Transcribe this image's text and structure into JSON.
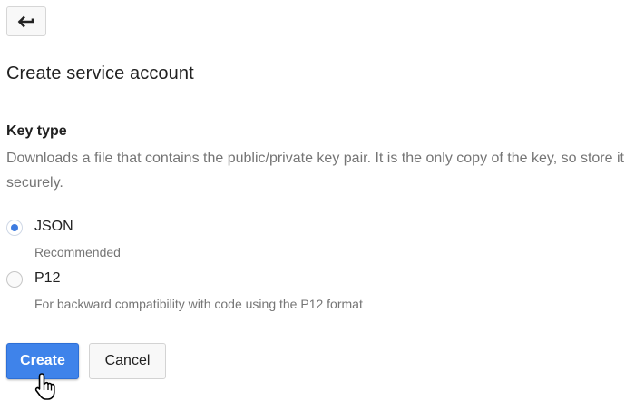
{
  "header": {
    "back_icon": "back-arrow-icon"
  },
  "page": {
    "title": "Create service account"
  },
  "key_type": {
    "title": "Key type",
    "description": "Downloads a file that contains the public/private key pair. It is the only copy of the key, so store it securely.",
    "options": [
      {
        "label": "JSON",
        "sublabel": "Recommended",
        "selected": true
      },
      {
        "label": "P12",
        "sublabel": "For backward compatibility with code using the P12 format",
        "selected": false
      }
    ]
  },
  "actions": {
    "create_label": "Create",
    "cancel_label": "Cancel"
  },
  "colors": {
    "accent": "#3f83ea",
    "text_primary": "#212121",
    "text_secondary": "#757575"
  },
  "cursor_icon": "hand-pointer-icon"
}
